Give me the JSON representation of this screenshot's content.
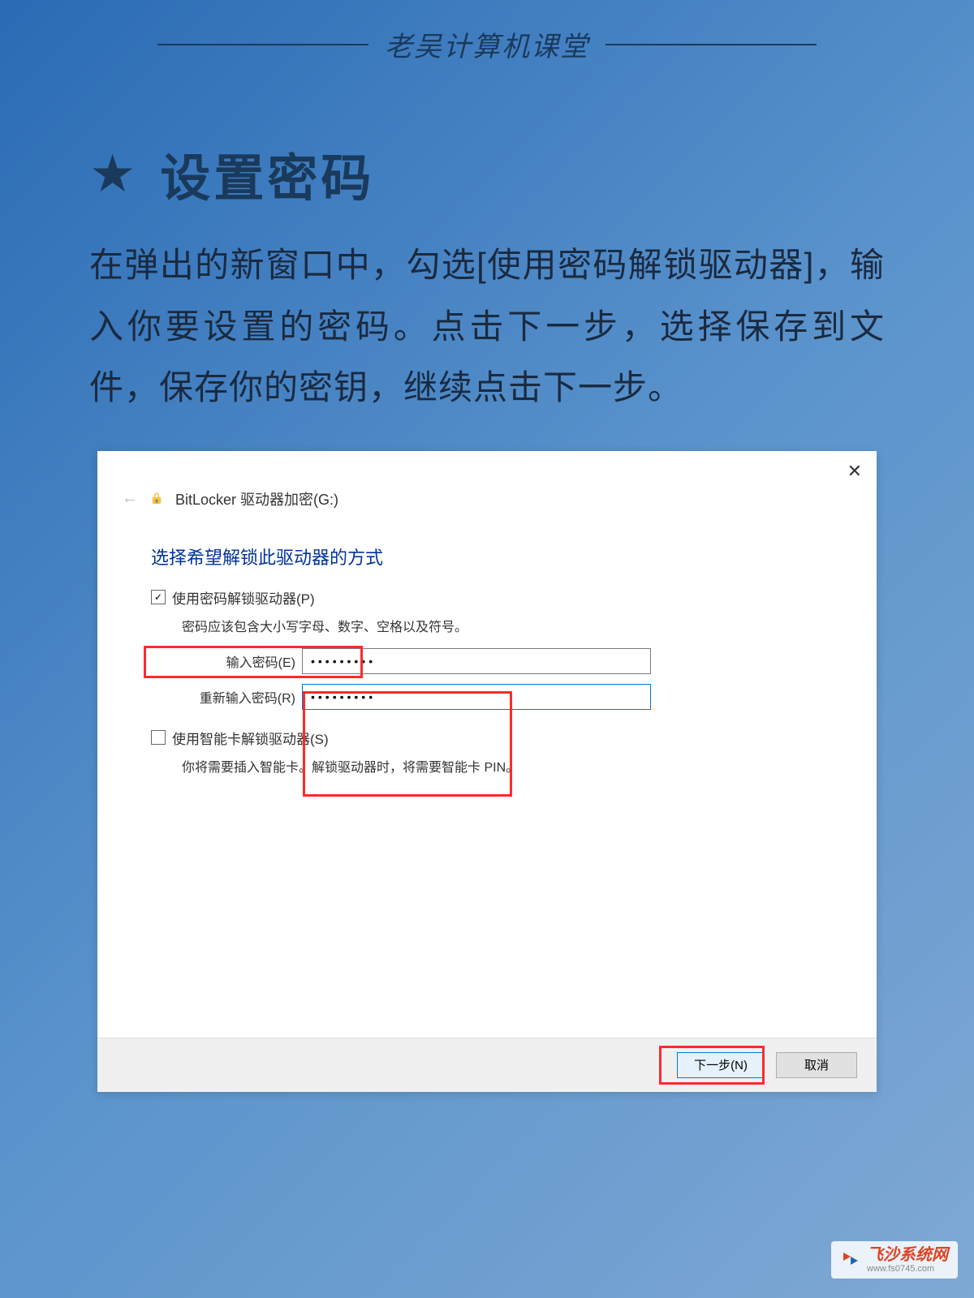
{
  "header": {
    "title": "老吴计算机课堂"
  },
  "section": {
    "star": "★",
    "title": "设置密码",
    "description": "在弹出的新窗口中，勾选[使用密码解锁驱动器]，输入你要设置的密码。点击下一步，选择保存到文件，保存你的密钥，继续点击下一步。"
  },
  "dialog": {
    "title": "BitLocker 驱动器加密(G:)",
    "close": "✕",
    "back": "←",
    "heading": "选择希望解锁此驱动器的方式",
    "password": {
      "checkbox_checked": true,
      "checkbox_mark": "✓",
      "label": "使用密码解锁驱动器(P)",
      "hint": "密码应该包含大小写字母、数字、空格以及符号。",
      "input_label": "输入密码(E)",
      "reinput_label": "重新输入密码(R)",
      "value": "•••••••••",
      "revalue": "•••••••••"
    },
    "smartcard": {
      "checkbox_checked": false,
      "label": "使用智能卡解锁驱动器(S)",
      "hint": "你将需要插入智能卡。解锁驱动器时，将需要智能卡 PIN。"
    },
    "buttons": {
      "next": "下一步(N)",
      "cancel": "取消"
    }
  },
  "watermark": {
    "name": "飞沙系统网",
    "url": "www.fs0745.com"
  }
}
